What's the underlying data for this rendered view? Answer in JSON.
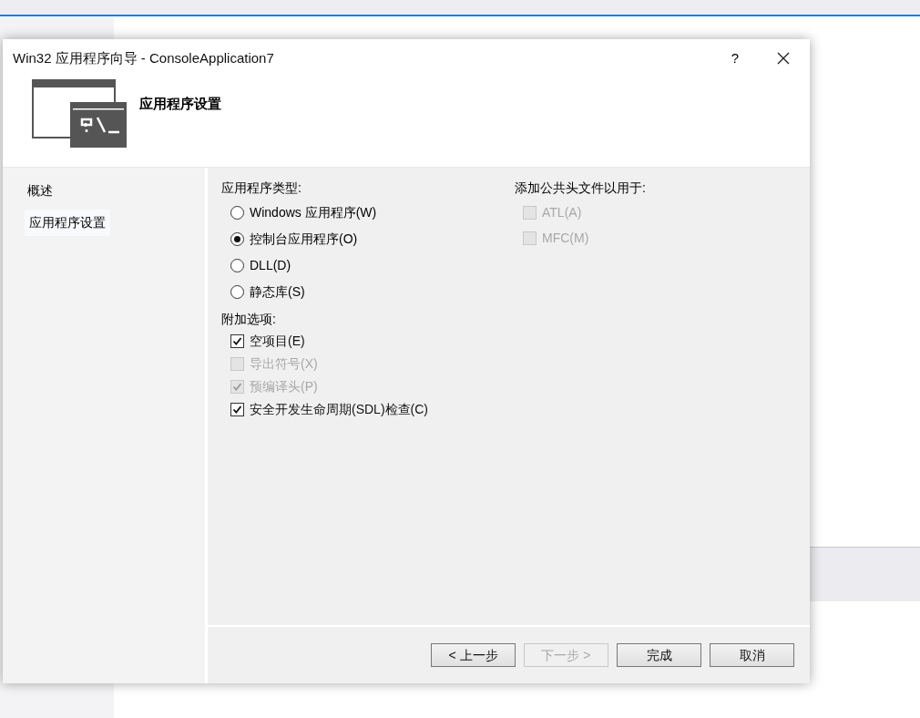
{
  "window": {
    "title": "Win32 应用程序向导 - ConsoleApplication7",
    "help": "?"
  },
  "header": {
    "title": "应用程序设置"
  },
  "nav": {
    "items": [
      {
        "label": "概述",
        "selected": false
      },
      {
        "label": "应用程序设置",
        "selected": true
      }
    ]
  },
  "app_type": {
    "label": "应用程序类型:",
    "options": [
      {
        "label": "Windows 应用程序(W)",
        "selected": false
      },
      {
        "label": "控制台应用程序(O)",
        "selected": true
      },
      {
        "label": "DLL(D)",
        "selected": false
      },
      {
        "label": "静态库(S)",
        "selected": false
      }
    ]
  },
  "extra": {
    "label": "附加选项:",
    "options": [
      {
        "label": "空项目(E)",
        "checked": true,
        "disabled": false
      },
      {
        "label": "导出符号(X)",
        "checked": false,
        "disabled": true
      },
      {
        "label": "预编译头(P)",
        "checked": true,
        "disabled": true
      },
      {
        "label": "安全开发生命周期(SDL)检查(C)",
        "checked": true,
        "disabled": false
      }
    ]
  },
  "headers": {
    "label": "添加公共头文件以用于:",
    "options": [
      {
        "label": "ATL(A)",
        "checked": false,
        "disabled": true
      },
      {
        "label": "MFC(M)",
        "checked": false,
        "disabled": true
      }
    ]
  },
  "buttons": [
    {
      "label": "< 上一步",
      "disabled": false
    },
    {
      "label": "下一步 >",
      "disabled": true
    },
    {
      "label": "完成",
      "disabled": false
    },
    {
      "label": "取消",
      "disabled": false
    }
  ]
}
